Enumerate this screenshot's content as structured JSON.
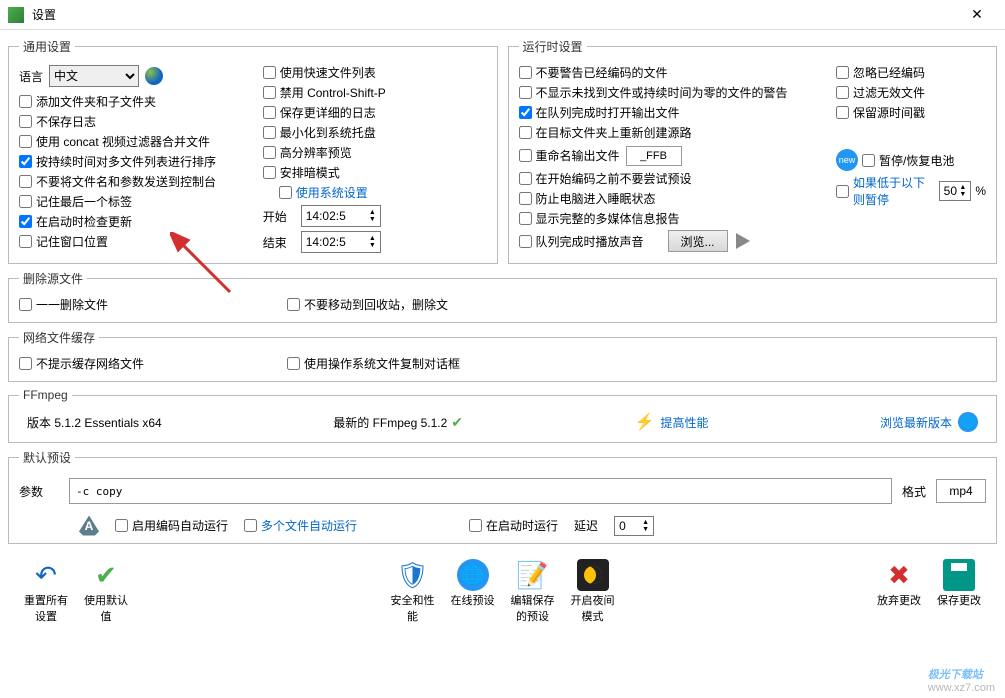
{
  "title": "设置",
  "general": {
    "legend": "通用设置",
    "lang_label": "语言",
    "lang_value": "中文",
    "col1": {
      "add_subfolders": "添加文件夹和子文件夹",
      "no_save_log": "不保存日志",
      "concat_filter": "使用 concat 视频过滤器合并文件",
      "sort_duration": "按持续时间对多文件列表进行排序",
      "no_send_console": "不要将文件名和参数发送到控制台",
      "remember_tab": "记住最后一个标签",
      "check_update": "在启动时检查更新",
      "remember_window": "记住窗口位置"
    },
    "col2": {
      "fast_filelist": "使用快速文件列表",
      "disable_csp": "禁用 Control-Shift-P",
      "save_detailed_log": "保存更详细的日志",
      "min_tray": "最小化到系统托盘",
      "high_dpi": "高分辨率预览",
      "dark_mode": "安排暗模式",
      "use_sys_settings": "使用系统设置",
      "start_label": "开始",
      "start_value": "14:02:5",
      "end_label": "结束",
      "end_value": "14:02:5"
    }
  },
  "runtime": {
    "legend": "运行时设置",
    "col1": {
      "no_warn_encoded": "不要警告已经编码的文件",
      "no_show_missing": "不显示未找到文件或持续时间为零的文件的警告",
      "open_on_complete": "在队列完成时打开输出文件",
      "recreate_source": "在目标文件夹上重新创建源路",
      "rename_output": "重命名输出文件",
      "rename_suffix": "_FFB",
      "no_try_preset": "在开始编码之前不要尝试预设",
      "no_sleep": "防止电脑进入睡眠状态",
      "show_full_report": "显示完整的多媒体信息报告",
      "play_sound": "队列完成时播放声音",
      "browse": "浏览..."
    },
    "col2": {
      "ignore_encoded": "忽略已经编码",
      "filter_invalid": "过滤无效文件",
      "keep_timestamp": "保留源时间戳",
      "pause_battery": "暂停/恢复电池",
      "pause_below": "如果低于以下则暂停",
      "pause_value": "50",
      "percent": "%"
    }
  },
  "delete_src": {
    "legend": "删除源文件",
    "delete_one": "一一删除文件",
    "no_recycle": "不要移动到回收站，删除文"
  },
  "net_cache": {
    "legend": "网络文件缓存",
    "no_prompt": "不提示缓存网络文件",
    "use_os_copy": "使用操作系统文件复制对话框"
  },
  "ffmpeg": {
    "legend": "FFmpeg",
    "version": "版本 5.1.2 Essentials  x64",
    "latest": "最新的 FFmpeg 5.1.2",
    "boost_perf": "提高性能",
    "browse_latest": "浏览最新版本"
  },
  "preset": {
    "legend": "默认预设",
    "param_label": "参数",
    "param_value": "-c copy",
    "format_label": "格式",
    "format_value": "mp4",
    "auto_run_encode": "启用编码自动运行",
    "multi_auto_run": "多个文件自动运行",
    "run_on_start": "在启动时运行",
    "delay_label": "延迟",
    "delay_value": "0"
  },
  "buttons": {
    "reset_all": "重置所有设置",
    "use_default": "使用默认值",
    "safe_perf": "安全和性能",
    "online_preset": "在线预设",
    "edit_saved": "编辑保存的预设",
    "night_mode": "开启夜间模式",
    "discard": "放弃更改",
    "save": "保存更改"
  },
  "watermark": {
    "brand": "极光下载站",
    "url": "www.xz7.com"
  }
}
